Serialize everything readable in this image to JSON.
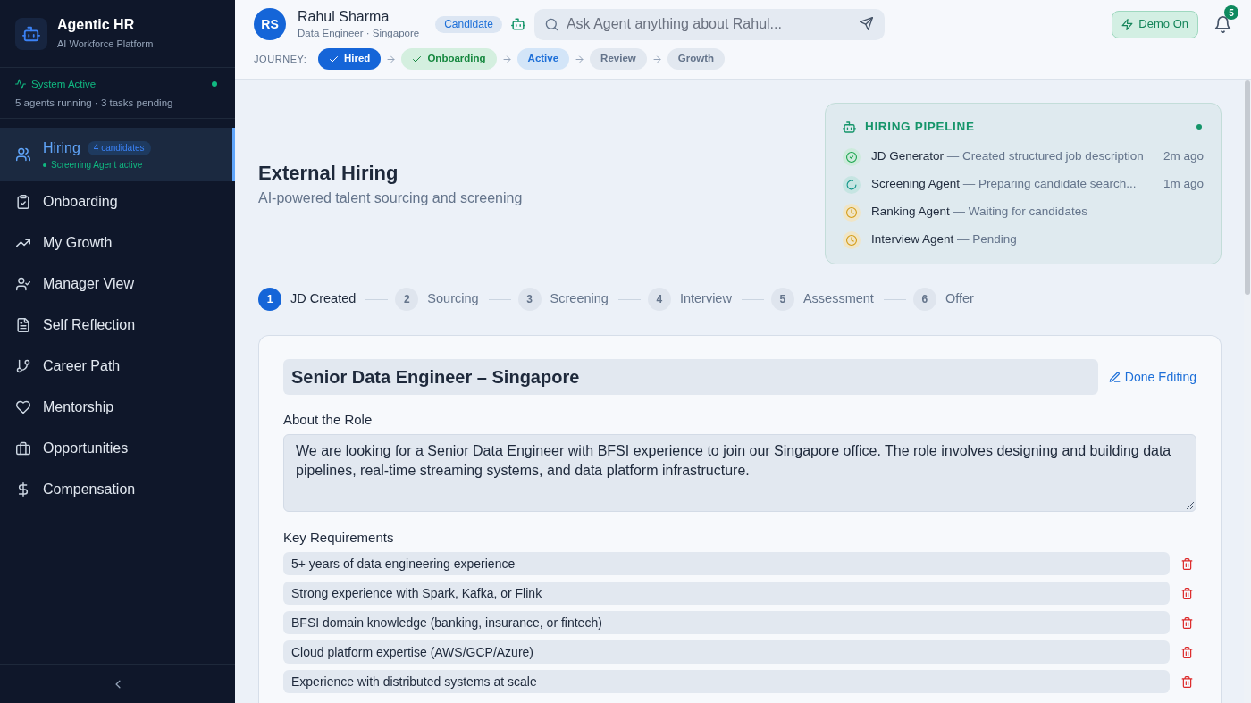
{
  "sidebar": {
    "brand": {
      "title": "Agentic HR",
      "subtitle": "AI Workforce Platform"
    },
    "system_status": {
      "label": "System Active",
      "detail": "5 agents running · 3 tasks pending",
      "online": true
    },
    "nav": [
      {
        "label": "Hiring",
        "badge": "4 candidates",
        "status": "Screening Agent active",
        "selected": true
      },
      {
        "label": "Onboarding",
        "selected": false
      },
      {
        "label": "My Growth",
        "selected": false
      },
      {
        "label": "Manager View",
        "selected": false
      },
      {
        "label": "Self Reflection",
        "selected": false
      },
      {
        "label": "Career Path",
        "selected": false
      },
      {
        "label": "Mentorship",
        "selected": false
      },
      {
        "label": "Opportunities",
        "selected": false
      },
      {
        "label": "Compensation",
        "selected": false
      }
    ]
  },
  "header": {
    "avatar": {
      "initials": "RS"
    },
    "name": "Rahul Sharma",
    "subtitle": "Data Engineer · Singapore",
    "role_badge": "Candidate",
    "search": {
      "placeholder": "Ask Agent anything about Rahul..."
    },
    "demo_button": {
      "label": "Demo On",
      "on": true
    },
    "notifications": {
      "count": "5"
    }
  },
  "journey": {
    "label": "JOURNEY:",
    "stages": [
      {
        "label": "Hired",
        "kind": "primary",
        "checked": true
      },
      {
        "label": "Onboarding",
        "kind": "success",
        "checked": true
      },
      {
        "label": "Active",
        "kind": "info",
        "checked": false
      },
      {
        "label": "Review",
        "kind": "neutral",
        "checked": false
      },
      {
        "label": "Growth",
        "kind": "neutral",
        "checked": false
      }
    ]
  },
  "page": {
    "title": "External Hiring",
    "subtitle": "AI-powered talent sourcing and screening"
  },
  "pipeline": {
    "title": "HIRING PIPELINE",
    "online": true,
    "agents": [
      {
        "name": "JD Generator",
        "detail": "— Created structured job description",
        "time": "2m ago",
        "kind": "done"
      },
      {
        "name": "Screening Agent",
        "detail": "— Preparing candidate search...",
        "time": "1m ago",
        "kind": "running"
      },
      {
        "name": "Ranking Agent",
        "detail": "— Waiting for candidates",
        "kind": "waiting"
      },
      {
        "name": "Interview Agent",
        "detail": "— Pending",
        "kind": "waiting"
      }
    ]
  },
  "steps": [
    {
      "number": "1",
      "label": "JD Created",
      "selected": true
    },
    {
      "number": "2",
      "label": "Sourcing",
      "selected": false
    },
    {
      "number": "3",
      "label": "Screening",
      "selected": false
    },
    {
      "number": "4",
      "label": "Interview",
      "selected": false
    },
    {
      "number": "5",
      "label": "Assessment",
      "selected": false
    },
    {
      "number": "6",
      "label": "Offer",
      "selected": false
    }
  ],
  "editor": {
    "title_field": {
      "value": "Senior Data Engineer – Singapore"
    },
    "done_button": "Done Editing",
    "about": {
      "label": "About the Role",
      "value": "We are looking for a Senior Data Engineer with BFSI experience to join our Singapore office. The role involves designing and building data pipelines, real-time streaming systems, and data platform infrastructure."
    },
    "requirements": {
      "label": "Key Requirements",
      "items": [
        {
          "value": "5+ years of data engineering experience"
        },
        {
          "value": "Strong experience with Spark, Kafka, or Flink"
        },
        {
          "value": "BFSI domain knowledge (banking, insurance, or fintech)"
        },
        {
          "value": "Cloud platform expertise (AWS/GCP/Azure)"
        },
        {
          "value": "Experience with distributed systems at scale"
        }
      ]
    }
  }
}
